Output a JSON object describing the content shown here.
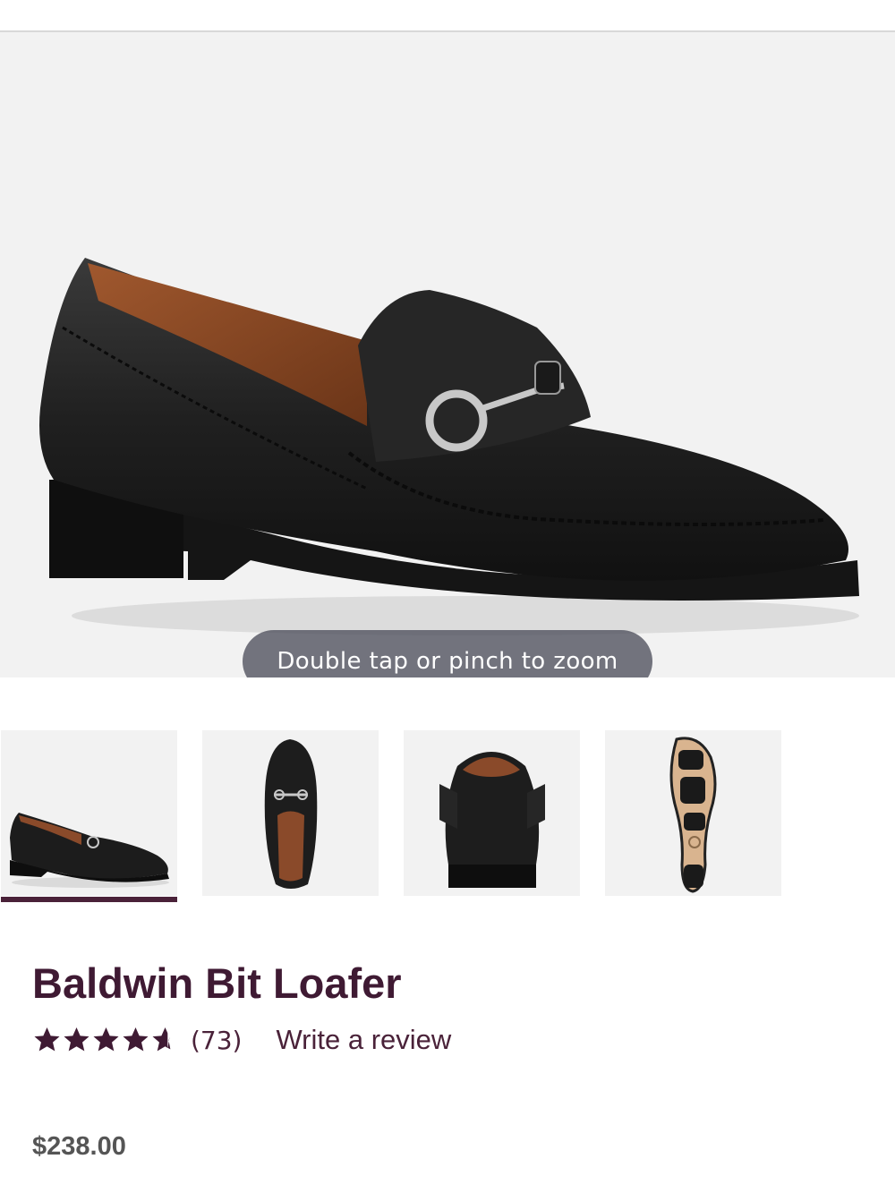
{
  "product": {
    "name": "Baldwin Bit Loafer",
    "rating": 4.5,
    "rating_max": 5,
    "review_count": "(73)",
    "write_review": "Write a review",
    "price": "$238.00"
  },
  "gallery": {
    "zoom_hint": "Double tap or pinch to zoom",
    "thumbnails": [
      {
        "view": "side-view",
        "selected": true
      },
      {
        "view": "top-view",
        "selected": false
      },
      {
        "view": "back-view",
        "selected": false
      },
      {
        "view": "sole-view",
        "selected": false
      }
    ]
  },
  "colors": {
    "brand": "#3f1a33",
    "indicator": "#4a2239",
    "shoe_leather": "#1e1e1e",
    "lining": "#8a4a2a",
    "sole_tan": "#d9b48f"
  }
}
